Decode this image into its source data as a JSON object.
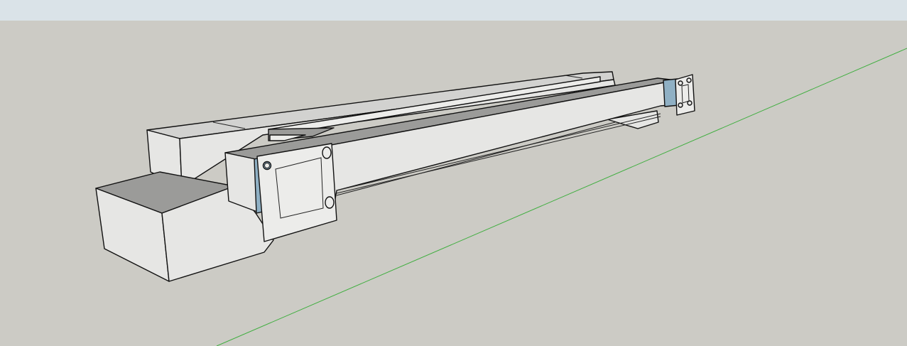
{
  "colors": {
    "sky": "#dae3e8",
    "ground": "#cccbc5",
    "face_top": "#d2d2d0",
    "face_light": "#e6e6e4",
    "face_mid": "#bdbdbb",
    "face_dark": "#9b9b99",
    "face_front": "#ececea",
    "glass": "#8fb0c4",
    "green_axis": "#3fae3f"
  },
  "scene": {
    "axis_name": "green-axis-line",
    "model_name": "3d-model-assembly"
  }
}
